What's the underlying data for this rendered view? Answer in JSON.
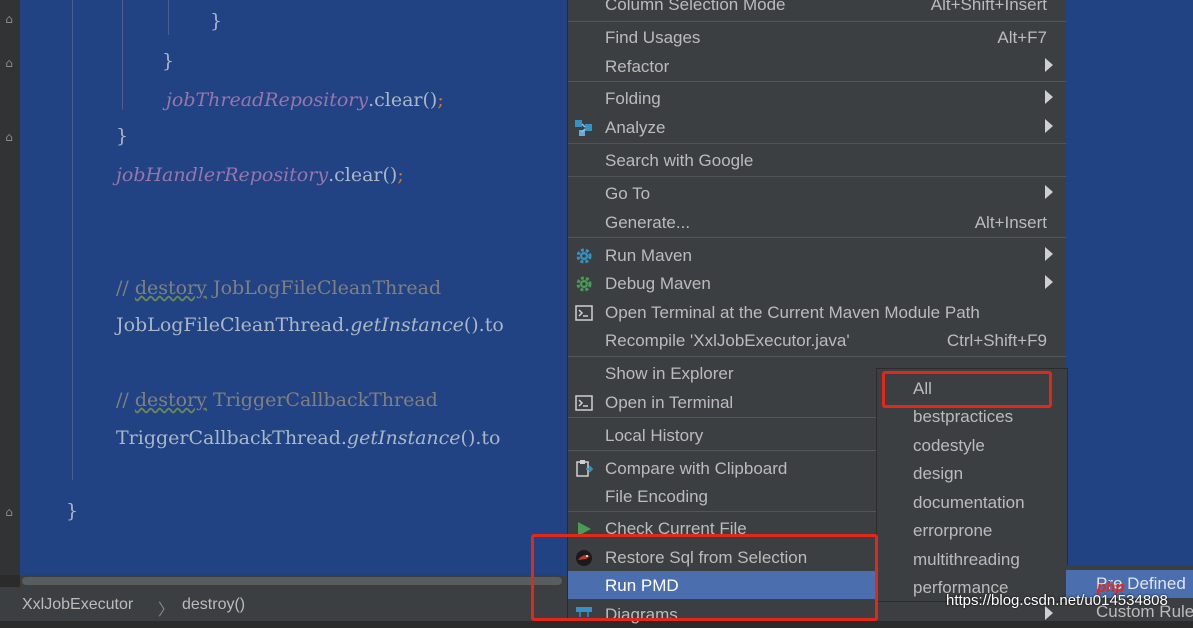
{
  "code": {
    "lines": [
      "}",
      "}",
      "jobThreadRepository",
      ".clear()",
      ";",
      "}",
      "jobHandlerRepository",
      ".clear()",
      ";",
      "// ",
      "destory",
      " JobLogFileCleanThread",
      "JobLogFileCleanThread.",
      "getInstance",
      "().to",
      "// ",
      "destory",
      " TriggerCallbackThread",
      "TriggerCallbackThread.",
      "getInstance",
      "().to",
      "}"
    ]
  },
  "status_bar": {
    "crumb_class": "XxlJobExecutor",
    "separator": "〉",
    "crumb_method": "destroy()"
  },
  "context_menu": {
    "items": [
      {
        "label": "Column Selection Mode",
        "shortcut": "Alt+Shift+Insert"
      },
      {
        "label": "Find Usages",
        "shortcut": "Alt+F7"
      },
      {
        "label": "Refactor",
        "submenu": true
      },
      {
        "label": "Folding",
        "submenu": true
      },
      {
        "label": "Analyze",
        "submenu": true,
        "icon": "analyze-icon"
      },
      {
        "label": "Search with Google"
      },
      {
        "label": "Go To",
        "submenu": true
      },
      {
        "label": "Generate...",
        "shortcut": "Alt+Insert"
      },
      {
        "label": "Run Maven",
        "submenu": true,
        "icon": "gear-icon"
      },
      {
        "label": "Debug Maven",
        "submenu": true,
        "icon": "gear-icon"
      },
      {
        "label": "Open Terminal at the Current Maven Module Path",
        "icon": "terminal-icon"
      },
      {
        "label": "Recompile 'XxlJobExecutor.java'",
        "shortcut": "Ctrl+Shift+F9"
      },
      {
        "label": "Show in Explorer"
      },
      {
        "label": "Open in Terminal",
        "icon": "terminal-icon"
      },
      {
        "label": "Local History",
        "submenu": true
      },
      {
        "label": "Compare with Clipboard",
        "icon": "clipboard-icon"
      },
      {
        "label": "File Encoding"
      },
      {
        "label": "Check Current File",
        "icon": "play-icon"
      },
      {
        "label": "Restore Sql from Selection",
        "icon": "bird-icon"
      },
      {
        "label": "Run PMD",
        "submenu": true,
        "selected": true
      },
      {
        "label": "Diagrams",
        "submenu": true,
        "icon": "diagram-icon"
      }
    ]
  },
  "pmd_submenu": {
    "items": [
      "All",
      "bestpractices",
      "codestyle",
      "design",
      "documentation",
      "errorprone",
      "multithreading",
      "performance"
    ]
  },
  "right_panel": {
    "item1": "Pre Defined",
    "item2": "Custom Rules"
  },
  "watermark": {
    "brand": "php",
    "text": "https://blog.csdn.net/u014534808"
  },
  "colors": {
    "editor_bg": "#214283",
    "menu_bg": "#3c3f41",
    "selection": "#4b6eaf",
    "highlight_box": "#e2281a"
  }
}
